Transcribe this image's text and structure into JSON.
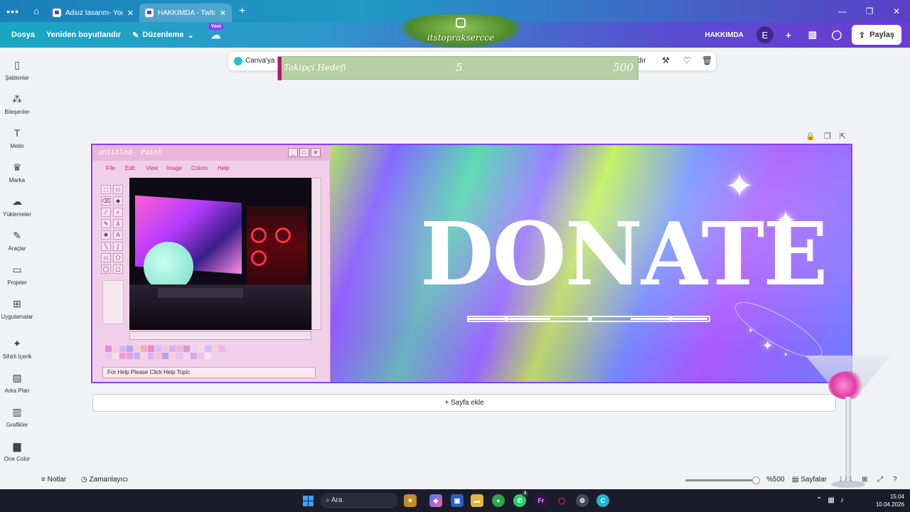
{
  "browser": {
    "tabs": [
      {
        "title": "Adsız tasarım- You...",
        "active": false
      },
      {
        "title": "HAKKIMDA - Twitc...",
        "active": true
      }
    ]
  },
  "topbar": {
    "menu": [
      "Dosya",
      "Yeniden boyutlandır",
      "Düzenleme"
    ],
    "badge_new": "Yeni",
    "design_title": "HAKKIMDA",
    "avatar_letter": "E",
    "share_label": "Paylaş"
  },
  "banner_overlay": {
    "handle": "itstopraksercce"
  },
  "sidebar": {
    "items": [
      {
        "label": "Şablonlar",
        "icon": "templates-icon"
      },
      {
        "label": "Bileşenler",
        "icon": "elements-icon"
      },
      {
        "label": "Metin",
        "icon": "text-icon"
      },
      {
        "label": "Marka",
        "icon": "brand-icon"
      },
      {
        "label": "Yüklemeler",
        "icon": "uploads-icon"
      },
      {
        "label": "Araçlar",
        "icon": "draw-icon"
      },
      {
        "label": "Projeler",
        "icon": "folder-icon"
      },
      {
        "label": "Uygulamalar",
        "icon": "apps-icon"
      },
      {
        "label": "Sihirli İçerik",
        "icon": "magic-icon"
      },
      {
        "label": "Arka Plan",
        "icon": "background-icon"
      },
      {
        "label": "Grafikler",
        "icon": "charts-icon"
      },
      {
        "label": "One Color",
        "icon": "onecolor-icon"
      }
    ]
  },
  "context_toolbar": {
    "canva_text": "Canva'ya s",
    "truncated_suffix": "dır"
  },
  "follower_goal": {
    "label": "Takipçi Hedefi",
    "current": "5",
    "target": "500"
  },
  "paint": {
    "title": "untitled- Paint",
    "menu": [
      "File",
      "Edit",
      "View",
      "Image",
      "Colors",
      "Help"
    ],
    "status": "For Help Please Click Help Topic"
  },
  "design": {
    "headline": "DONATE"
  },
  "add_page": "+ Sayfa ekle",
  "bottom": {
    "notes": "Notlar",
    "timer": "Zamanlayıcı",
    "zoom": "%500",
    "zoom_level": 1.0,
    "pages": "Sayfalar",
    "page_count": "1 / 1"
  },
  "taskbar": {
    "search": "Ara",
    "time": "15:04",
    "date": "10.04.2026",
    "whatsapp_badge": "3"
  },
  "colors": {
    "accent": "#8b3dff",
    "goal_bar": "#b6cfa4",
    "goal_accent": "#b3186c"
  }
}
